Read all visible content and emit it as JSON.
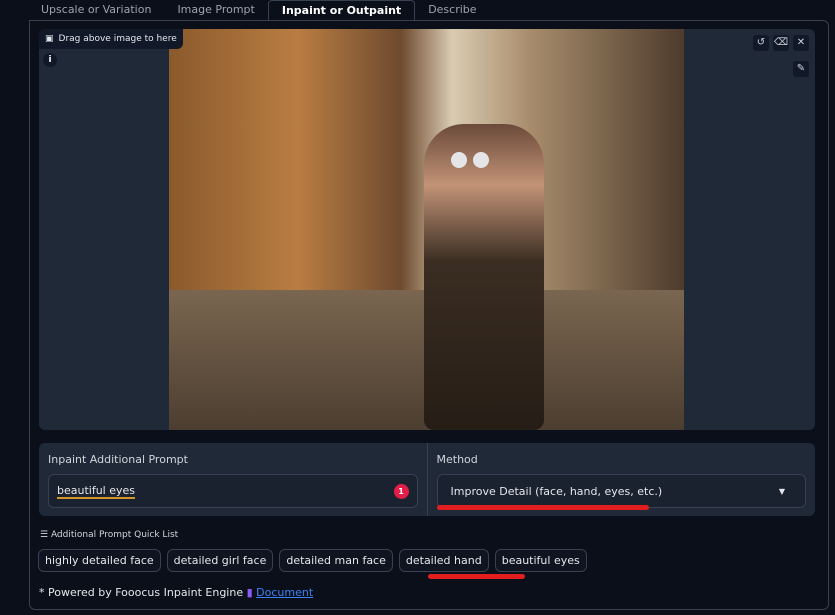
{
  "tabs": [
    {
      "label": "Upscale or Variation"
    },
    {
      "label": "Image Prompt"
    },
    {
      "label": "Inpaint or Outpaint",
      "active": true
    },
    {
      "label": "Describe"
    }
  ],
  "canvas": {
    "drop_label": "Drag above image to here",
    "info": "i"
  },
  "inpaint": {
    "label": "Inpaint Additional Prompt",
    "value": "beautiful eyes",
    "badge": "1"
  },
  "method": {
    "label": "Method",
    "value": "Improve Detail (face, hand, eyes, etc.)"
  },
  "quick_list": {
    "label": "Additional Prompt Quick List",
    "items": [
      "highly detailed face",
      "detailed girl face",
      "detailed man face",
      "detailed hand",
      "beautiful eyes"
    ]
  },
  "footer": {
    "text": "* Powered by Fooocus Inpaint Engine ",
    "link": "Document"
  },
  "colors": {
    "annotation": "#e11d1d",
    "badge": "#e11d48",
    "link": "#3b82f6"
  }
}
